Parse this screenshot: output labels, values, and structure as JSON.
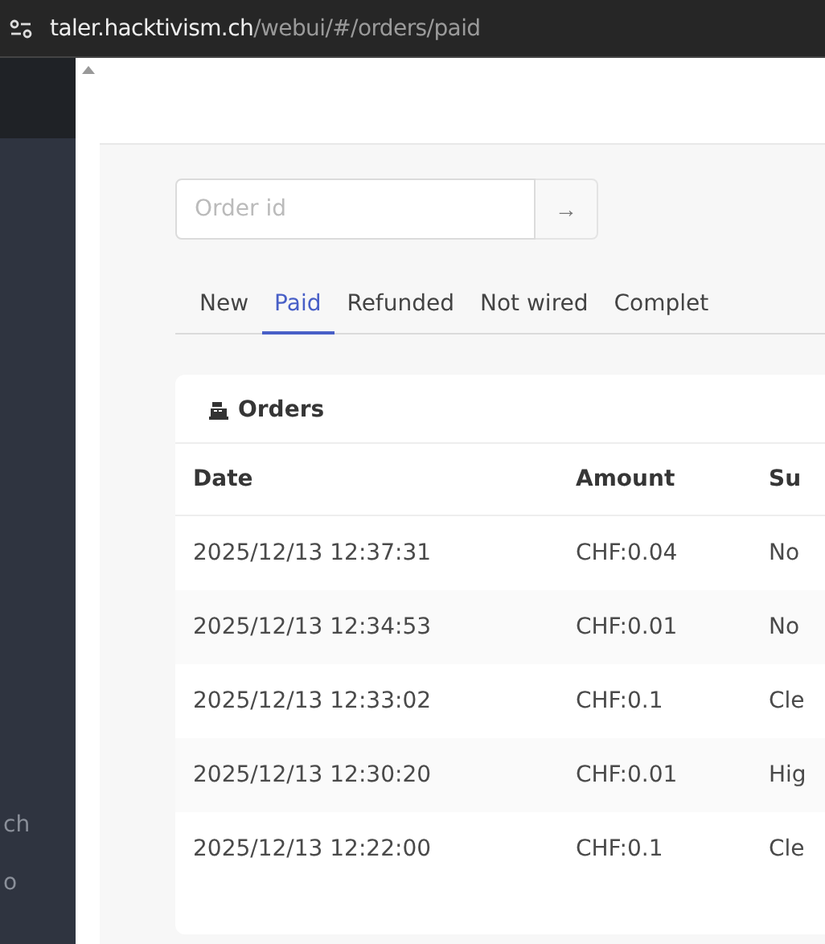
{
  "address_bar": {
    "host": "taler.hacktivism.ch",
    "path": "/webui/#/orders/paid"
  },
  "sidebar": {
    "items": [
      "ch",
      "o"
    ]
  },
  "search": {
    "placeholder": "Order id",
    "button": "→"
  },
  "tabs": [
    {
      "label": "New",
      "selected": false
    },
    {
      "label": "Paid",
      "selected": true
    },
    {
      "label": "Refunded",
      "selected": false
    },
    {
      "label": "Not wired",
      "selected": false
    },
    {
      "label": "Complet",
      "selected": false
    }
  ],
  "orders": {
    "title": "Orders",
    "columns": [
      "Date",
      "Amount",
      "Su"
    ],
    "rows": [
      {
        "cells": [
          "2025/12/13 12:37:31",
          "CHF:0.04",
          "No"
        ]
      },
      {
        "cells": [
          "2025/12/13 12:34:53",
          "CHF:0.01",
          "No"
        ]
      },
      {
        "cells": [
          "2025/12/13 12:33:02",
          "CHF:0.1",
          "Cle"
        ]
      },
      {
        "cells": [
          "2025/12/13 12:30:20",
          "CHF:0.01",
          "Hig"
        ]
      },
      {
        "cells": [
          "2025/12/13 12:22:00",
          "CHF:0.1",
          "Cle"
        ]
      }
    ]
  }
}
